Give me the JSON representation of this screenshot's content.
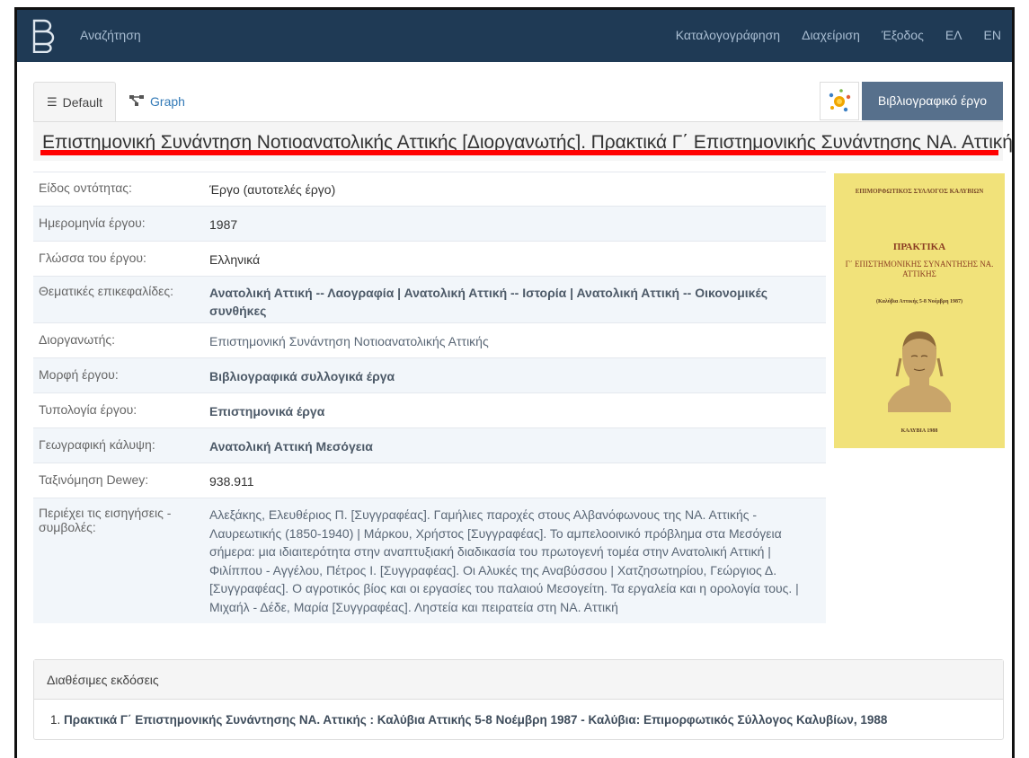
{
  "navbar": {
    "search": "Αναζήτηση",
    "links": [
      "Καταλογογράφηση",
      "Διαχείριση",
      "Έξοδος",
      "ΕΛ",
      "EN"
    ]
  },
  "tabs": {
    "default": "Default",
    "graph": "Graph"
  },
  "type_button": "Βιβλιογραφικό έργο",
  "title": "Επιστημονική Συνάντηση Νοτιοανατολικής Αττικής [Διοργανωτής]. Πρακτικά Γ΄ Επιστημονικής Συνάντησης ΝΑ. Αττικής",
  "properties": [
    {
      "label": "Είδος οντότητας:",
      "value": "Έργο (αυτοτελές έργο)"
    },
    {
      "label": "Ημερομηνία έργου:",
      "value": "1987"
    },
    {
      "label": "Γλώσσα του έργου:",
      "value": "Ελληνικά"
    },
    {
      "label": "Θεματικές επικεφαλίδες:",
      "value": "Ανατολική Αττική -- Λαογραφία | Ανατολική Αττική -- Ιστορία | Ανατολική Αττική -- Οικονομικές συνθήκες"
    },
    {
      "label": "Διοργανωτής:",
      "value": "Επιστημονική Συνάντηση Νοτιοανατολικής Αττικής"
    },
    {
      "label": "Μορφή έργου:",
      "value": "Βιβλιογραφικά συλλογικά έργα"
    },
    {
      "label": "Τυπολογία έργου:",
      "value": "Επιστημονικά έργα"
    },
    {
      "label": "Γεωγραφική κάλυψη:",
      "value": "Ανατολική Αττική Μεσόγεια"
    },
    {
      "label": "Ταξινόμηση Dewey:",
      "value": "938.911"
    },
    {
      "label": "Περιέχει τις εισηγήσεις - συμβολές:",
      "value": "Αλεξάκης, Ελευθέριος Π. [Συγγραφέας]. Γαμήλιες παροχές στους Αλβανόφωνους της ΝΑ. Αττικής - Λαυρεωτικής (1850-1940) | Μάρκου, Χρήστος [Συγγραφέας]. Το αμπελοοινικό πρόβλημα στα Μεσόγεια σήμερα: μια ιδιαιτερότητα στην αναπτυξιακή διαδικασία του πρωτογενή τομέα στην Ανατολική Αττική | Φιλίππου - Αγγέλου, Πέτρος Ι. [Συγγραφέας]. Οι Αλυκές της Αναβύσσου | Χατζησωτηρίου, Γεώργιος Δ. [Συγγραφέας]. Ο αγροτικός βίος και οι εργασίες του παλαιού Μεσογείτη. Τα εργαλεία και η ορολογία τους. | Μιχαήλ - Δέδε, Μαρία [Συγγραφέας]. Ληστεία και πειρατεία στη ΝΑ. Αττική"
    }
  ],
  "cover": {
    "publisher": "ΕΠΙΜΟΡΦΩΤΙΚΟΣ ΣΥΛΛΟΓΟΣ ΚΑΛΥΒΙΩΝ",
    "heading": "ΠΡΑΚΤΙΚΑ",
    "subheading": "Γ΄ ΕΠΙΣΤΗΜΟΝΙΚΗΣ ΣΥΝΑΝΤΗΣΗΣ ΝΑ. ΑΤΤΙΚΗΣ",
    "dates": "(Καλύβια Αττικής 5-8 Νοέμβρη 1987)",
    "footer": "ΚΑΛΥΒΙΑ 1988"
  },
  "editions": {
    "header": "Διαθέσιμες εκδόσεις",
    "items": [
      {
        "number": "1.",
        "text": "Πρακτικά Γ΄ Επιστημονικής Συνάντησης ΝΑ. Αττικής : Καλύβια Αττικής 5-8 Νοέμβρη 1987 - Καλύβια: Επιμορφωτικός Σύλλογος Καλυβίων, 1988"
      }
    ]
  },
  "colors": {
    "navbar": "#1f3a55",
    "type_button": "#57708c",
    "underline": "#ff0000",
    "cover": "#f1e27a"
  }
}
